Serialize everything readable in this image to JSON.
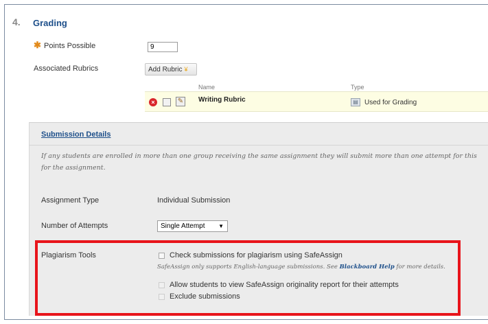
{
  "section": {
    "number": "4.",
    "title": "Grading"
  },
  "points": {
    "required_mark": "✱",
    "label": "Points Possible",
    "value": "9"
  },
  "rubrics": {
    "label": "Associated Rubrics",
    "add_button": "Add Rubric",
    "add_chevron": "¥",
    "col_name": "Name",
    "col_type": "Type",
    "rows": [
      {
        "name": "Writing Rubric",
        "type": "Used for Grading"
      }
    ]
  },
  "submission": {
    "heading": "Submission Details",
    "note_line1": "If any students are enrolled in more than one group receiving the same assignment they will submit more than one attempt for this",
    "note_line2": "for the assignment.",
    "assignment_type_label": "Assignment Type",
    "assignment_type_value": "Individual Submission",
    "attempts_label": "Number of Attempts",
    "attempts_value": "Single Attempt"
  },
  "plagiarism": {
    "label": "Plagiarism Tools",
    "check_label": "Check submissions for plagiarism using SafeAssign",
    "note_before": "SafeAssign only supports English-language submissions. See ",
    "note_link": "Blackboard Help",
    "note_after": " for more details.",
    "allow_view_label": "Allow students to view SafeAssign originality report for their attempts",
    "exclude_label": "Exclude submissions"
  },
  "colors": {
    "accent": "#1d4f8a",
    "highlight": "#e8141b",
    "required": "#e28a1a"
  }
}
